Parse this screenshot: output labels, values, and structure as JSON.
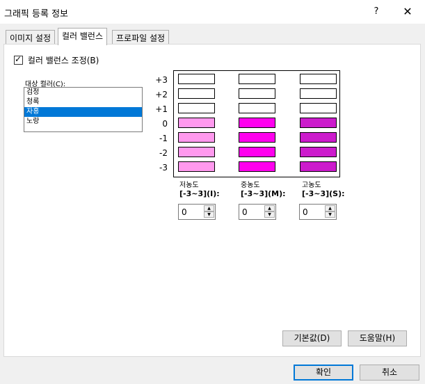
{
  "window": {
    "title": "그래픽 등록 정보",
    "help": "?",
    "close": "✕"
  },
  "tabs": [
    {
      "label": "이미지 설정",
      "active": false
    },
    {
      "label": "컬러 밸런스",
      "active": true
    },
    {
      "label": "프로파일 설정",
      "active": false
    }
  ],
  "color_balance": {
    "enable_checkbox": {
      "label": "컬러 밸런스 조정(B)",
      "checked": true,
      "mark": "✓"
    },
    "target_color_label": "대상 컬러(C):",
    "target_colors": [
      {
        "label": "검정",
        "selected": false
      },
      {
        "label": "청록",
        "selected": false
      },
      {
        "label": "자홍",
        "selected": true
      },
      {
        "label": "노랑",
        "selected": false
      }
    ],
    "levels": [
      "+3",
      "+2",
      "+1",
      "0",
      "-1",
      "-2",
      "-3"
    ],
    "columns": [
      {
        "name_line1": "저농도",
        "name_line2": "[-3~3](I):",
        "value": "0",
        "filled_color": "#ff99ee"
      },
      {
        "name_line1": "중농도",
        "name_line2": "[-3~3](M):",
        "value": "0",
        "filled_color": "#ff00ee"
      },
      {
        "name_line1": "고농도",
        "name_line2": "[-3~3](S):",
        "value": "0",
        "filled_color": "#cc1bcc"
      }
    ],
    "current_level": 0,
    "empty_color": "#ffffff",
    "spin_up": "▲",
    "spin_down": "▼",
    "default_button": "기본값(D)",
    "help_button": "도움말(H)"
  },
  "dialog_buttons": {
    "ok": "확인",
    "cancel": "취소"
  }
}
